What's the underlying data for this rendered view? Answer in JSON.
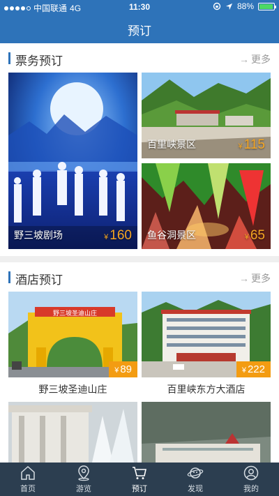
{
  "status": {
    "carrier": "中国联通",
    "network": "4G",
    "time": "11:30",
    "battery": "88%",
    "battery_level": 0.88
  },
  "header": {
    "title": "预订"
  },
  "tickets": {
    "title": "票务预订",
    "more": "更多",
    "items": [
      {
        "name": "野三坡剧场",
        "currency": "¥",
        "price": "160"
      },
      {
        "name": "百里峡景区",
        "currency": "¥",
        "price": "115"
      },
      {
        "name": "鱼谷洞景区",
        "currency": "¥",
        "price": "65"
      }
    ]
  },
  "hotels": {
    "title": "酒店预订",
    "more": "更多",
    "items": [
      {
        "name": "野三坡圣迪山庄",
        "currency": "¥",
        "price": "89",
        "sign": "野三坡圣迪山庄"
      },
      {
        "name": "百里峡东方大酒店",
        "currency": "¥",
        "price": "222"
      }
    ]
  },
  "tabs": [
    {
      "label": "首页",
      "icon": "home-icon"
    },
    {
      "label": "游览",
      "icon": "location-icon"
    },
    {
      "label": "预订",
      "icon": "cart-icon",
      "active": true
    },
    {
      "label": "发现",
      "icon": "planet-icon"
    },
    {
      "label": "我的",
      "icon": "user-icon"
    }
  ],
  "colors": {
    "brand": "#2e73b9",
    "tabbar": "#2c3e50",
    "price_badge": "#f39c12"
  }
}
